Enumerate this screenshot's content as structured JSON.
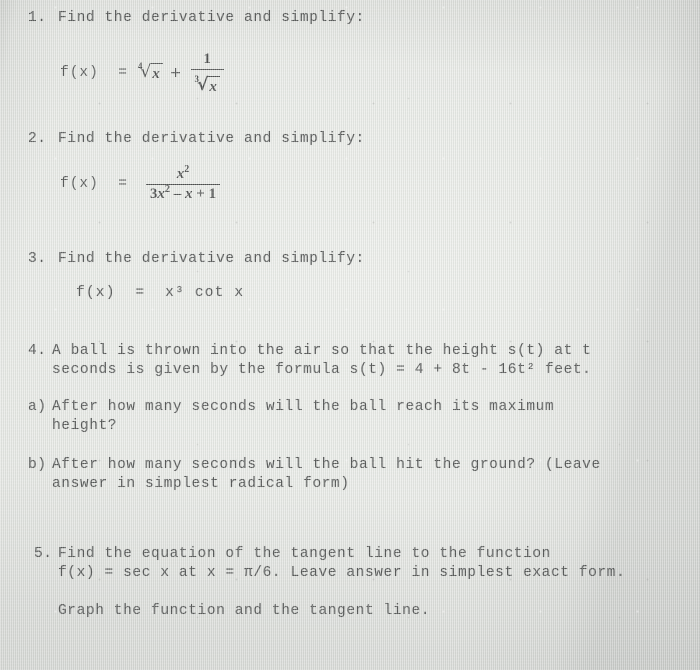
{
  "document": {
    "type": "scanned-worksheet",
    "subject": "calculus-derivatives",
    "background_color": "#e7e9e5",
    "ink_color": "#3b3d3d"
  },
  "problems": [
    {
      "number": "1.",
      "prompt": "Find the derivative and simplify:",
      "equation": {
        "lhs": "f(x)  =",
        "root1_index": "4",
        "root1_radicand": "x",
        "operator": "+",
        "fraction_numerator": "1",
        "root2_index": "3",
        "root2_radicand": "x"
      }
    },
    {
      "number": "2.",
      "prompt": "Find the derivative and simplify:",
      "equation": {
        "lhs": "f(x)  =",
        "numerator_base": "x",
        "numerator_exp": "2",
        "denominator": "3x2 - x + 1",
        "den_coef": "3",
        "den_var1": "x",
        "den_exp1": "2",
        "den_minus": " – ",
        "den_var2": "x",
        "den_plus": " + ",
        "den_const": "1"
      }
    },
    {
      "number": "3.",
      "prompt": "Find the derivative and simplify:",
      "equation_text": "f(x)  =  x³ cot x"
    },
    {
      "number": "4.",
      "line1": "A ball is thrown into the air so that the height s(t) at t",
      "line2": "seconds is given by the formula s(t) = 4 + 8t - 16t² feet.",
      "parts": [
        {
          "label": "a)",
          "line1": "After how many seconds will the ball reach its maximum",
          "line2": "height?"
        },
        {
          "label": "b)",
          "line1": "After how many seconds will the ball hit the ground? (Leave",
          "line2": "answer in simplest radical form)"
        }
      ]
    },
    {
      "number": "5.",
      "line1": "Find the equation of the tangent line to the function",
      "line2": "f(x) = sec x at x = π/6. Leave answer in simplest exact form.",
      "line3": "Graph the function and the tangent line."
    }
  ]
}
